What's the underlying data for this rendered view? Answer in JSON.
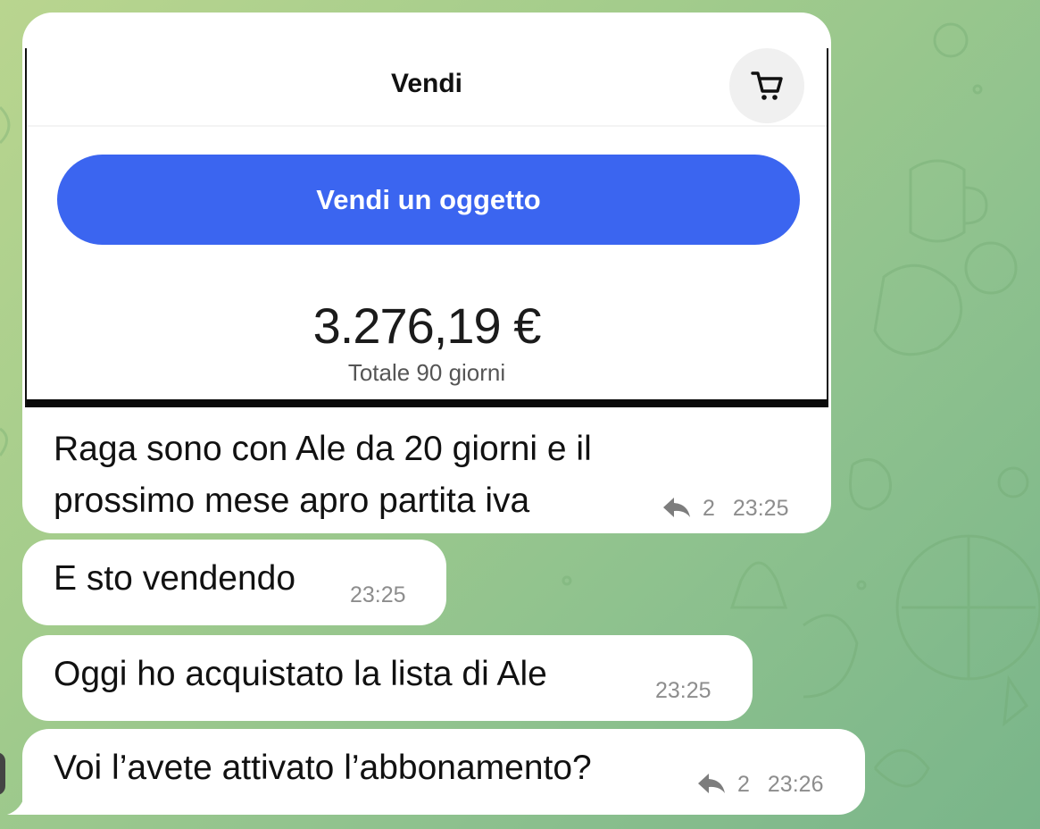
{
  "screenshot": {
    "title": "Vendi",
    "cart_icon": "cart-icon",
    "sell_button_label": "Vendi un oggetto",
    "amount": "3.276,19 €",
    "amount_caption": "Totale 90 giorni",
    "accent_color": "#3b65f0"
  },
  "messages": [
    {
      "text_line1": "Raga sono con Ale da 20 giorni e il",
      "text_line2": "prossimo mese apro partita iva",
      "replies": "2",
      "time": "23:25"
    },
    {
      "text": "E sto vendendo",
      "time": "23:25"
    },
    {
      "text": "Oggi ho acquistato la lista di Ale",
      "time": "23:25"
    },
    {
      "text": "Voi l’avete attivato l’abbonamento?",
      "replies": "2",
      "time": "23:26"
    }
  ]
}
